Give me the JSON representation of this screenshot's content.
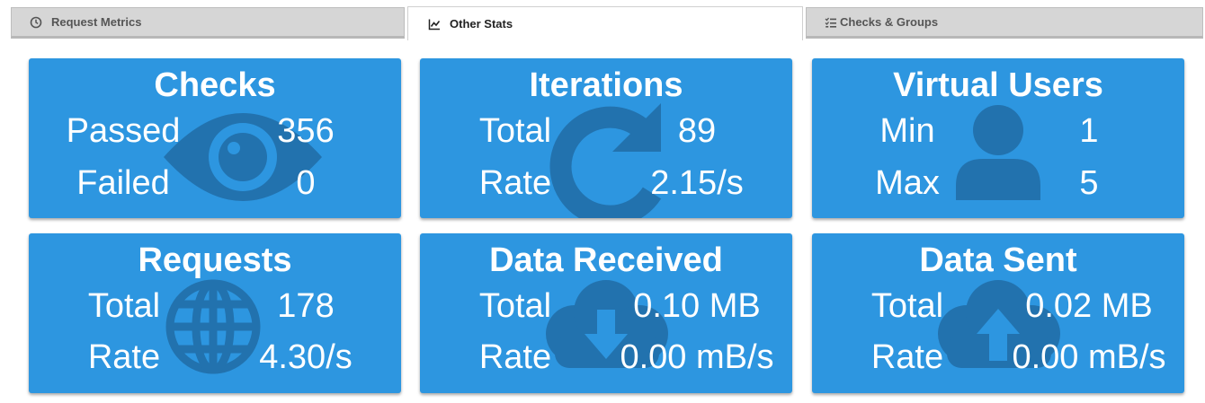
{
  "tabs": [
    {
      "label": "Request Metrics",
      "icon": "clock-icon",
      "active": false
    },
    {
      "label": "Other Stats",
      "icon": "chart-line-icon",
      "active": true
    },
    {
      "label": "Checks & Groups",
      "icon": "checklist-icon",
      "active": false
    }
  ],
  "colors": {
    "card": "#2d96e0",
    "icon_overlay": "#2272ae",
    "tab_bg": "#d6d6d6"
  },
  "cards": [
    {
      "title": "Checks",
      "icon": "eye-icon",
      "rows": [
        {
          "label": "Passed",
          "value": "356"
        },
        {
          "label": "Failed",
          "value": "0"
        }
      ]
    },
    {
      "title": "Iterations",
      "icon": "redo-icon",
      "rows": [
        {
          "label": "Total",
          "value": "89"
        },
        {
          "label": "Rate",
          "value": "2.15/s"
        }
      ]
    },
    {
      "title": "Virtual Users",
      "icon": "user-icon",
      "rows": [
        {
          "label": "Min",
          "value": "1"
        },
        {
          "label": "Max",
          "value": "5"
        }
      ]
    },
    {
      "title": "Requests",
      "icon": "globe-icon",
      "rows": [
        {
          "label": "Total",
          "value": "178"
        },
        {
          "label": "Rate",
          "value": "4.30/s"
        }
      ]
    },
    {
      "title": "Data Received",
      "icon": "cloud-download-icon",
      "rows": [
        {
          "label": "Total",
          "value": "0.10 MB"
        },
        {
          "label": "Rate",
          "value": "0.00 mB/s"
        }
      ]
    },
    {
      "title": "Data Sent",
      "icon": "cloud-upload-icon",
      "rows": [
        {
          "label": "Total",
          "value": "0.02 MB"
        },
        {
          "label": "Rate",
          "value": "0.00 mB/s"
        }
      ]
    }
  ]
}
